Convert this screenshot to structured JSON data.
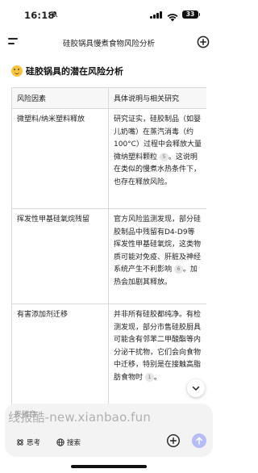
{
  "status_bar": {
    "time": "16:18",
    "mute_icon": "bell-slash",
    "battery": "33"
  },
  "header": {
    "title": "硅胶锅具慢煮食物风险分析",
    "menu_icon": "menu-icon",
    "new_chat_icon": "plus-circle-icon"
  },
  "section": {
    "emoji": "thinking-face",
    "title": "硅胶锅具的潜在风险分析"
  },
  "table": {
    "headers": [
      "风险因素",
      "具体说明与相关研究"
    ],
    "rows": [
      {
        "factor": "微塑料/纳米塑料释放",
        "detail": "研究证实，硅胶制品（如婴儿奶嘴）在蒸汽消毒（约100°C）过程中会释放大量微纳塑料颗粒",
        "cite": "5",
        "detail_tail": "。这说明在类似的慢煮水热条件下，也存在释放风险。"
      },
      {
        "factor": "挥发性甲基硅氧烷残留",
        "detail": "官方风险监测发现，部分硅胶制品中残留有D4-D9等挥发性甲基硅氧烷，这类物质可能对免疫、肝脏及神经系统产生不利影响",
        "cite": "6",
        "detail_tail": "。加热会加剧其释放。"
      },
      {
        "factor": "有害添加剂迁移",
        "detail": "并非所有硅胶都纯净。有检测发现，部分市售硅胶厨具可能含有邻苯二甲酸酯等内分泌干扰物，它们会向食物中迁移，特别是在接触高脂肪食物时",
        "cite": "1",
        "detail_tail": "。"
      }
    ]
  },
  "composer": {
    "placeholder": "发消息",
    "think_label": "思考",
    "search_label": "搜索"
  },
  "watermark": "线报酷-new.xianbao.fun",
  "colors": {
    "accent_send": "#b6bcf5",
    "table_border": "#d9d9d9"
  }
}
